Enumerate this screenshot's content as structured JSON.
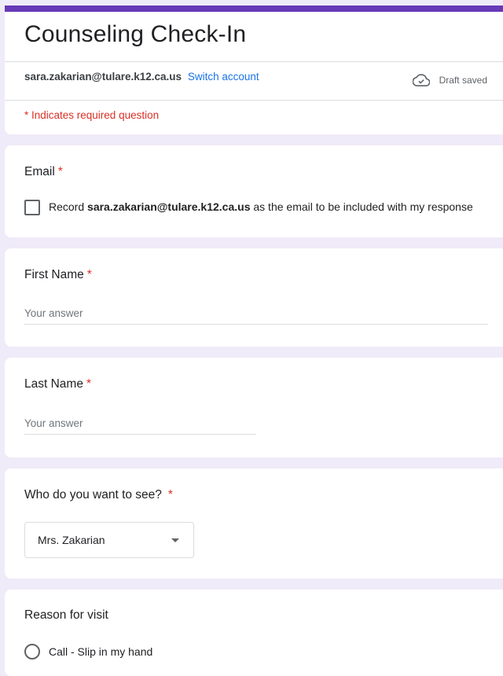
{
  "form": {
    "title": "Counseling Check-In",
    "account_email": "sara.zakarian@tulare.k12.ca.us",
    "switch_account": "Switch account",
    "draft_status": "Draft saved",
    "required_note": "* Indicates required question"
  },
  "colors": {
    "accent": "#673ab7",
    "background": "#f0ebf8",
    "required": "#d93025",
    "link": "#1a73e8"
  },
  "questions": {
    "email": {
      "label": "Email",
      "required_mark": "*",
      "record_prefix": "Record",
      "record_email": "sara.zakarian@tulare.k12.ca.us",
      "record_suffix": "as the email to be included with my response",
      "checked": false
    },
    "first_name": {
      "label": "First Name",
      "required_mark": "*",
      "placeholder": "Your answer",
      "value": ""
    },
    "last_name": {
      "label": "Last Name",
      "required_mark": "*",
      "placeholder": "Your answer",
      "value": ""
    },
    "who": {
      "label": "Who do you want to see?",
      "required_mark": "*",
      "selected": "Mrs. Zakarian"
    },
    "reason": {
      "label": "Reason for visit",
      "options": [
        {
          "label": "Call - Slip in my hand",
          "selected": false
        }
      ]
    }
  },
  "icons": {
    "draft": "cloud-check-icon",
    "dropdown": "caret-down-icon"
  }
}
